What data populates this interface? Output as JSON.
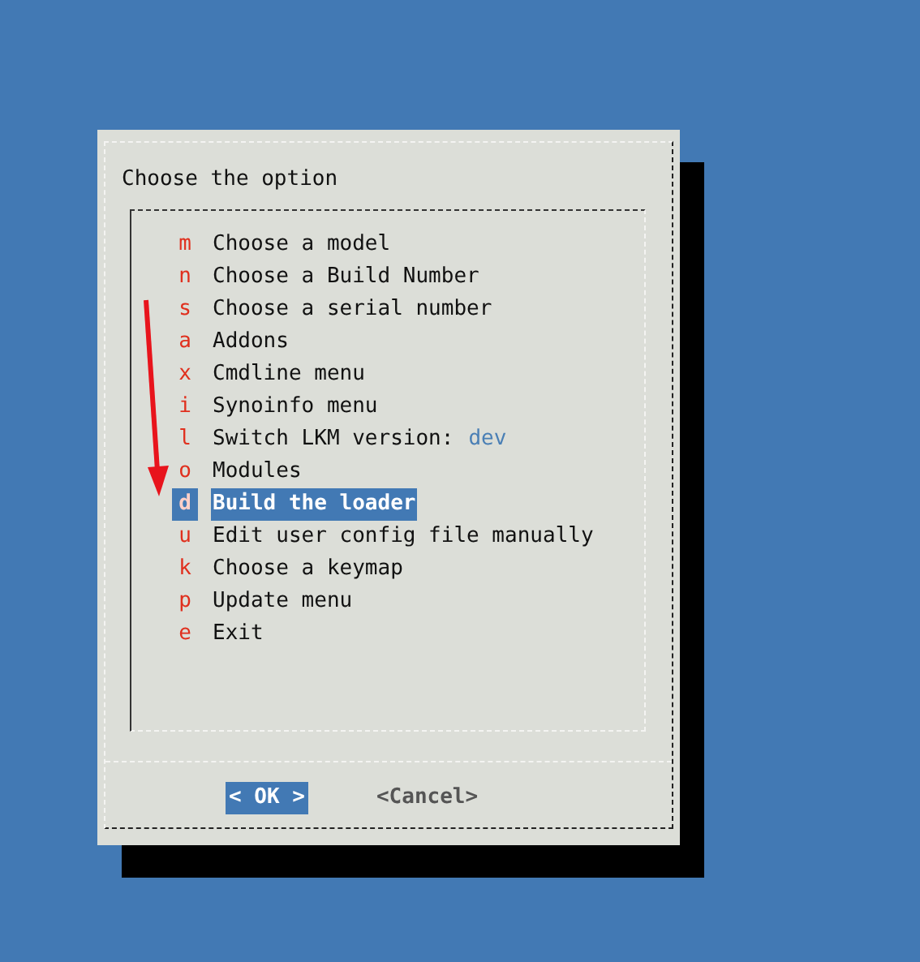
{
  "dialog": {
    "title": "Choose the option",
    "items": [
      {
        "key": "m",
        "label": "Choose a model",
        "selected": false
      },
      {
        "key": "n",
        "label": "Choose a Build Number",
        "selected": false
      },
      {
        "key": "s",
        "label": "Choose a serial number",
        "selected": false
      },
      {
        "key": "a",
        "label": "Addons",
        "selected": false
      },
      {
        "key": "x",
        "label": "Cmdline menu",
        "selected": false
      },
      {
        "key": "i",
        "label": "Synoinfo menu",
        "selected": false
      },
      {
        "key": "l",
        "label": "Switch LKM version:",
        "value": "dev",
        "selected": false
      },
      {
        "key": "o",
        "label": "Modules",
        "selected": false
      },
      {
        "key": "d",
        "label": "Build the loader",
        "selected": true
      },
      {
        "key": "u",
        "label": "Edit user config file manually",
        "selected": false
      },
      {
        "key": "k",
        "label": "Choose a keymap",
        "selected": false
      },
      {
        "key": "p",
        "label": "Update menu",
        "selected": false
      },
      {
        "key": "e",
        "label": "Exit",
        "selected": false
      }
    ],
    "buttons": [
      {
        "label": "< OK >",
        "selected": true
      },
      {
        "label": "<Cancel>",
        "selected": false
      }
    ]
  }
}
